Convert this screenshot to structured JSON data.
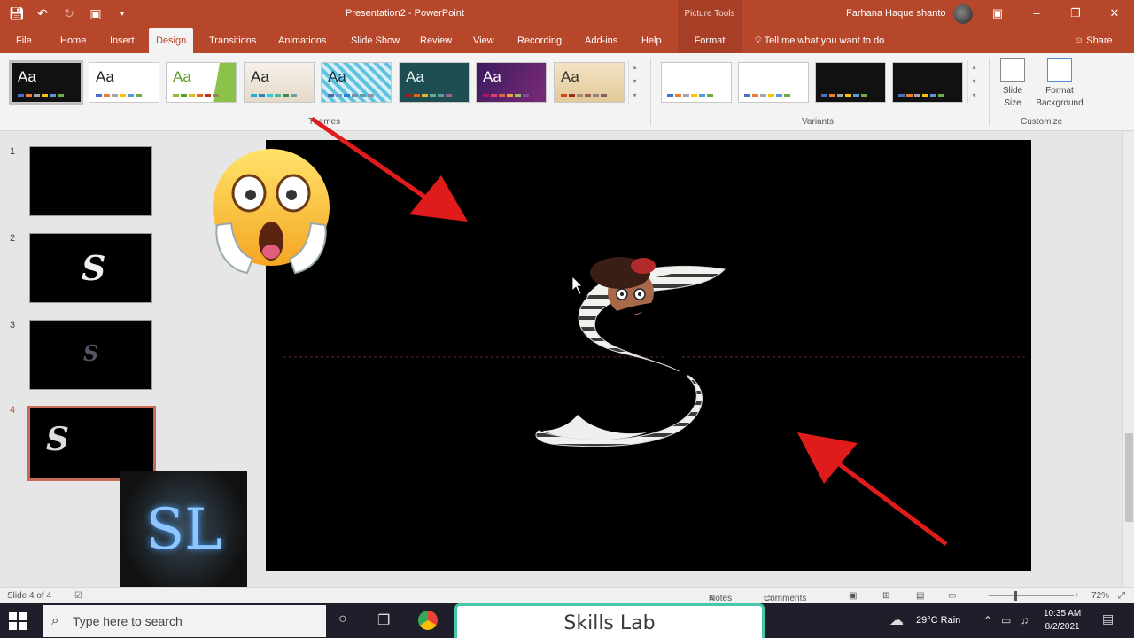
{
  "window": {
    "title": "Presentation2  -  PowerPoint",
    "context_group": "Picture Tools",
    "user": "Farhana Haque shanto"
  },
  "tabs": [
    "File",
    "Home",
    "Insert",
    "Design",
    "Transitions",
    "Animations",
    "Slide Show",
    "Review",
    "View",
    "Recording",
    "Add-ins",
    "Help"
  ],
  "active_tab": "Design",
  "context_tab": "Format",
  "tell_me": "Tell me what you want to do",
  "share": "Share",
  "ribbon": {
    "themes_label": "Themes",
    "variants_label": "Variants",
    "customize_label": "Customize",
    "theme_aa": "Aa",
    "slide_size": "Slide Size",
    "format_background": "Format Background"
  },
  "slides": [
    {
      "num": "1",
      "glyph": ""
    },
    {
      "num": "2",
      "glyph": "S"
    },
    {
      "num": "3",
      "glyph": "S"
    },
    {
      "num": "4",
      "glyph": "S"
    }
  ],
  "main_slide": {
    "glyph": "S"
  },
  "status": {
    "slide_indicator": "Slide 4 of 4",
    "notes": "Notes",
    "comments": "Comments",
    "zoom": "72%"
  },
  "taskbar": {
    "search_placeholder": "Type here to search",
    "weather": "29°C  Rain",
    "time": "10:35 AM",
    "date": "8/2/2021"
  },
  "overlay": {
    "banner": "Skills Lab",
    "logo": "SL"
  },
  "colors": {
    "brand": "#b7472a",
    "arrow": "#e01b1b",
    "accent_banner": "#46c8a8"
  }
}
